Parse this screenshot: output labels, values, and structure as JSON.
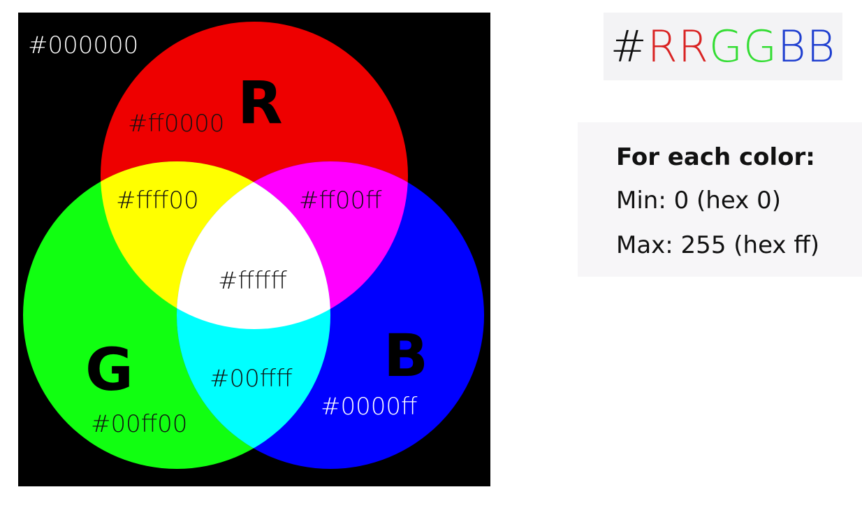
{
  "diagram": {
    "background_label": "#000000",
    "circles": {
      "red": {
        "letter": "R",
        "hex_label": "#ff0000",
        "color": "#ff0000"
      },
      "green": {
        "letter": "G",
        "hex_label": "#00ff00",
        "color": "#00ff00"
      },
      "blue": {
        "letter": "B",
        "hex_label": "#0000ff",
        "color": "#0000ff"
      }
    },
    "overlaps": {
      "red_green": "#ffff00",
      "red_blue": "#ff00ff",
      "green_blue": "#00ffff",
      "all": "#ffffff"
    }
  },
  "title": {
    "hash": "#",
    "rr": "RR",
    "gg": "GG",
    "bb": "BB",
    "colors": {
      "hash": "#111111",
      "rr": "#d92323",
      "gg": "#33dd33",
      "bb": "#1f3fd0"
    }
  },
  "info": {
    "heading": "For each color:",
    "min_line": "Min: 0 (hex 0)",
    "max_line": "Max: 255 (hex ff)"
  }
}
